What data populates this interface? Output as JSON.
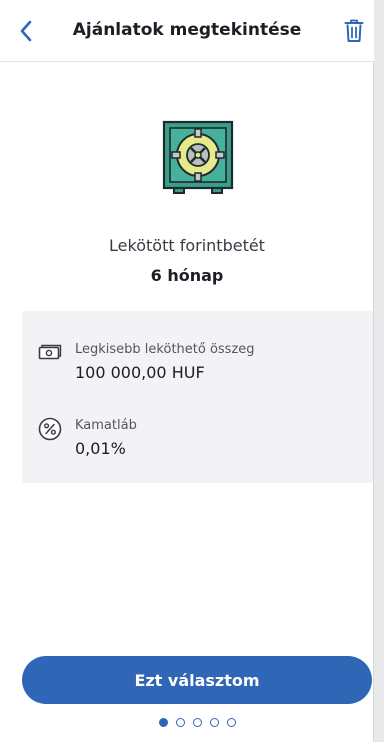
{
  "header": {
    "title": "Ajánlatok megtekintése",
    "back_icon": "chevron-left-icon",
    "delete_icon": "trash-icon"
  },
  "product": {
    "icon": "safe-icon",
    "name": "Lekötött forintbetét",
    "term": "6 hónap"
  },
  "details": [
    {
      "icon": "banknote-icon",
      "label": "Legkisebb leköthető összeg",
      "value": "100 000,00 HUF"
    },
    {
      "icon": "percent-icon",
      "label": "Kamatláb",
      "value": "0,01%"
    }
  ],
  "actions": {
    "choose_label": "Ezt választom"
  },
  "pager": {
    "total": 5,
    "current": 1
  },
  "colors": {
    "accent": "#2f66b6",
    "safe_body": "#3a9e8c",
    "safe_dial": "#e6ea8a",
    "details_bg": "#f3f3f6"
  }
}
